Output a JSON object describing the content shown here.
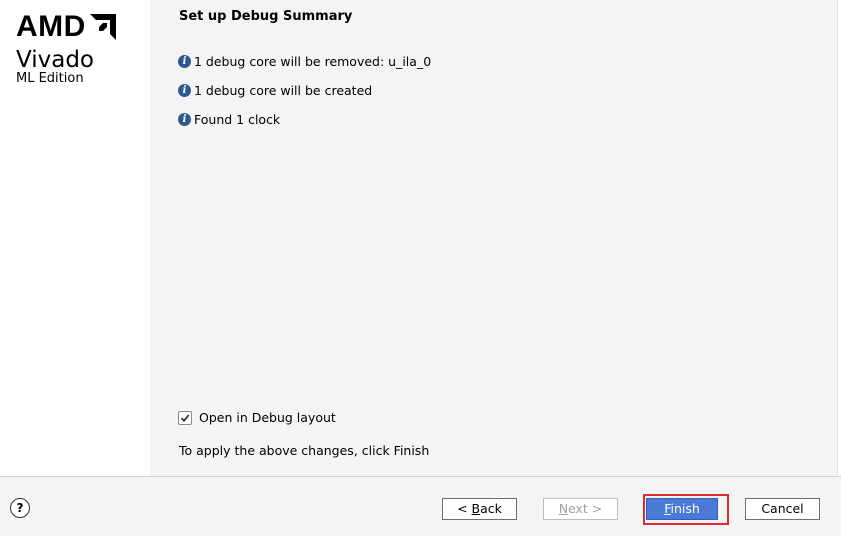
{
  "brand": {
    "company": "AMD",
    "product": "Vivado",
    "edition": "ML Edition"
  },
  "page": {
    "title": "Set up Debug Summary",
    "messages": [
      "1 debug core will be removed: u_ila_0",
      "1 debug core will be created",
      "Found 1 clock"
    ],
    "checkbox": {
      "label": "Open in Debug layout",
      "checked": true
    },
    "apply_text": "To apply the above changes, click Finish"
  },
  "footer": {
    "help": "?",
    "back": {
      "prefix": "< ",
      "mnemonic": "B",
      "rest": "ack"
    },
    "next": {
      "mnemonic": "N",
      "rest": "ext >"
    },
    "finish": {
      "mnemonic": "F",
      "rest": "inish"
    },
    "cancel": "Cancel"
  },
  "colors": {
    "primary_button": "#4a7ad5",
    "highlight": "#e32a32",
    "info_icon": "#2d5a8d"
  },
  "icons": {
    "info": "info-icon",
    "help": "help-icon",
    "check": "checkmark-icon"
  }
}
